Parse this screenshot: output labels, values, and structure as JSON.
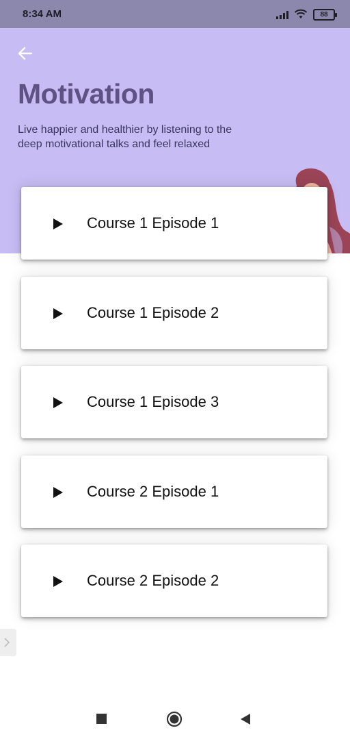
{
  "status_bar": {
    "time": "8:34 AM",
    "battery": "88",
    "icons": [
      "signal-icon",
      "wifi-icon",
      "battery-icon"
    ]
  },
  "header": {
    "back_icon": "arrow-left-icon",
    "title": "Motivation",
    "subtitle": "Live happier and healthier by listening to the deep motivational talks and feel relaxed",
    "background_color": "#c7bcf3",
    "title_color": "#5d5283"
  },
  "episodes": [
    {
      "label": "Course 1 Episode 1",
      "icon": "play-icon"
    },
    {
      "label": "Course 1 Episode 2",
      "icon": "play-icon"
    },
    {
      "label": "Course 1 Episode 3",
      "icon": "play-icon"
    },
    {
      "label": "Course 2 Episode 1",
      "icon": "play-icon"
    },
    {
      "label": "Course 2 Episode 2",
      "icon": "play-icon"
    }
  ],
  "nav_bar": {
    "buttons": [
      "recents-square-icon",
      "home-circle-icon",
      "back-triangle-icon"
    ]
  }
}
